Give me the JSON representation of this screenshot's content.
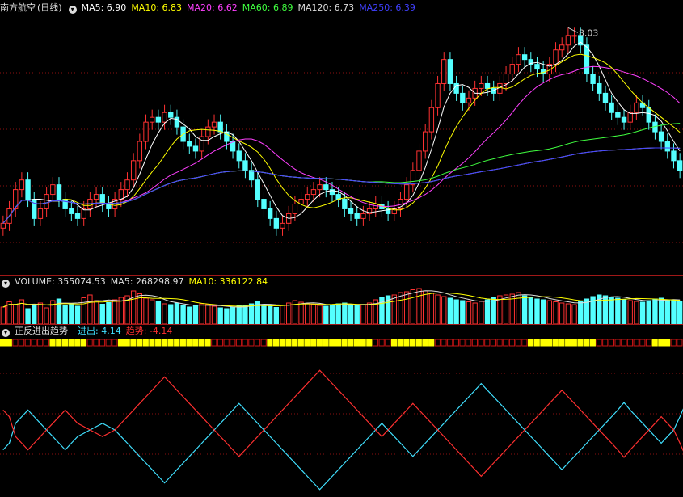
{
  "price_panel": {
    "stock_name": "南方航空",
    "period": "(日线)",
    "ma_labels": [
      {
        "text": "MA5: 6.90",
        "color": "#ffffff"
      },
      {
        "text": "MA10: 6.83",
        "color": "#ffff00"
      },
      {
        "text": "MA20: 6.62",
        "color": "#ff40ff"
      },
      {
        "text": "MA60: 6.89",
        "color": "#40ff40"
      },
      {
        "text": "MA120: 6.73",
        "color": "#dddddd"
      },
      {
        "text": "MA250: 6.39",
        "color": "#4040ff"
      }
    ],
    "high_marker": "8.03"
  },
  "volume_panel": {
    "labels": [
      {
        "text": "VOLUME: 355074.53",
        "color": "#dddddd"
      },
      {
        "text": "MA5: 268298.97",
        "color": "#dddddd"
      },
      {
        "text": "MA10: 336122.84",
        "color": "#ffff00"
      }
    ]
  },
  "indicator_panel": {
    "name": "正反进出趋势",
    "labels": [
      {
        "text": "进出: 4.14",
        "color": "#40e0ff"
      },
      {
        "text": "趋势: -4.14",
        "color": "#ff3030"
      }
    ]
  },
  "colors": {
    "up": "#ff3232",
    "down": "#54ffff",
    "grid": "#8b1010",
    "signal_on": "#ffff00",
    "signal_off": "#c81414"
  },
  "chart_data": {
    "type": "candlestick",
    "ylim": [
      5.6,
      8.2
    ],
    "close": [
      6.05,
      6.2,
      6.4,
      6.5,
      6.3,
      6.1,
      6.2,
      6.35,
      6.45,
      6.3,
      6.2,
      6.15,
      6.1,
      6.2,
      6.3,
      6.35,
      6.25,
      6.2,
      6.3,
      6.4,
      6.5,
      6.7,
      6.9,
      7.1,
      7.15,
      7.1,
      7.2,
      7.15,
      7.05,
      6.9,
      6.85,
      6.8,
      6.95,
      7.05,
      7.1,
      7.0,
      6.9,
      6.8,
      6.7,
      6.6,
      6.5,
      6.3,
      6.2,
      6.1,
      6.0,
      6.05,
      6.15,
      6.25,
      6.3,
      6.35,
      6.4,
      6.45,
      6.4,
      6.35,
      6.3,
      6.2,
      6.15,
      6.1,
      6.15,
      6.2,
      6.25,
      6.2,
      6.15,
      6.2,
      6.3,
      6.45,
      6.6,
      6.8,
      7.0,
      7.25,
      7.5,
      7.75,
      7.5,
      7.4,
      7.3,
      7.35,
      7.45,
      7.5,
      7.45,
      7.4,
      7.5,
      7.6,
      7.7,
      7.8,
      7.75,
      7.7,
      7.65,
      7.6,
      7.7,
      7.85,
      7.9,
      8.0,
      8.0,
      7.9,
      7.6,
      7.5,
      7.4,
      7.3,
      7.2,
      7.15,
      7.1,
      7.2,
      7.3,
      7.25,
      7.1,
      7.0,
      6.9,
      6.8,
      6.7,
      6.6
    ],
    "volume": [
      42,
      55,
      48,
      60,
      38,
      45,
      52,
      40,
      58,
      62,
      47,
      50,
      44,
      65,
      72,
      58,
      49,
      53,
      60,
      66,
      70,
      82,
      75,
      64,
      60,
      55,
      50,
      48,
      52,
      45,
      42,
      46,
      50,
      48,
      44,
      40,
      38,
      42,
      45,
      47,
      50,
      55,
      48,
      44,
      41,
      46,
      52,
      58,
      54,
      50,
      48,
      46,
      44,
      47,
      50,
      52,
      48,
      45,
      47,
      52,
      60,
      66,
      70,
      72,
      78,
      80,
      85,
      88,
      82,
      76,
      72,
      68,
      64,
      60,
      58,
      55,
      52,
      56,
      60,
      65,
      70,
      72,
      74,
      78,
      70,
      66,
      62,
      60,
      58,
      55,
      52,
      50,
      48,
      56,
      62,
      68,
      72,
      70,
      66,
      64,
      60,
      58,
      56,
      54,
      58,
      62,
      64,
      60,
      58,
      55
    ],
    "series": [
      {
        "name": "进出",
        "color": "#40e0ff",
        "values": [
          -3,
          -2,
          1,
          2,
          3,
          2,
          1,
          0,
          -1,
          -2,
          -3,
          -2,
          -1,
          -0.5,
          0,
          0.5,
          1,
          0.5,
          0,
          -1,
          -2,
          -3,
          -4,
          -5,
          -6,
          -7,
          -8,
          -7,
          -6,
          -5,
          -4,
          -3,
          -2,
          -1,
          0,
          1,
          2,
          3,
          4,
          3,
          2,
          1,
          0,
          -1,
          -2,
          -3,
          -4,
          -5,
          -6,
          -7,
          -8,
          -9,
          -8,
          -7,
          -6,
          -5,
          -4,
          -3,
          -2,
          -1,
          0,
          1,
          0,
          -1,
          -2,
          -3,
          -4,
          -3,
          -2,
          -1,
          0,
          1,
          2,
          3,
          4,
          5,
          6,
          7,
          6,
          5,
          4,
          3,
          2,
          1,
          0,
          -1,
          -2,
          -3,
          -4,
          -5,
          -6,
          -5,
          -4,
          -3,
          -2,
          -1,
          0,
          1,
          2,
          3,
          4.14,
          3,
          2,
          1,
          0,
          -1,
          -2,
          -1,
          0,
          2,
          4.14
        ]
      },
      {
        "name": "趋势",
        "color": "#ff3030",
        "values": [
          3,
          2,
          -1,
          -2,
          -3,
          -2,
          -1,
          0,
          1,
          2,
          3,
          2,
          1,
          0.5,
          0,
          -0.5,
          -1,
          -0.5,
          0,
          1,
          2,
          3,
          4,
          5,
          6,
          7,
          8,
          7,
          6,
          5,
          4,
          3,
          2,
          1,
          0,
          -1,
          -2,
          -3,
          -4,
          -3,
          -2,
          -1,
          0,
          1,
          2,
          3,
          4,
          5,
          6,
          7,
          8,
          9,
          8,
          7,
          6,
          5,
          4,
          3,
          2,
          1,
          0,
          -1,
          0,
          1,
          2,
          3,
          4,
          3,
          2,
          1,
          0,
          -1,
          -2,
          -3,
          -4,
          -5,
          -6,
          -7,
          -6,
          -5,
          -4,
          -3,
          -2,
          -1,
          0,
          1,
          2,
          3,
          4,
          5,
          6,
          5,
          4,
          3,
          2,
          1,
          0,
          -1,
          -2,
          -3,
          -4.14,
          -3,
          -2,
          -1,
          0,
          1,
          2,
          1,
          0,
          -2,
          -4.14
        ]
      }
    ]
  }
}
